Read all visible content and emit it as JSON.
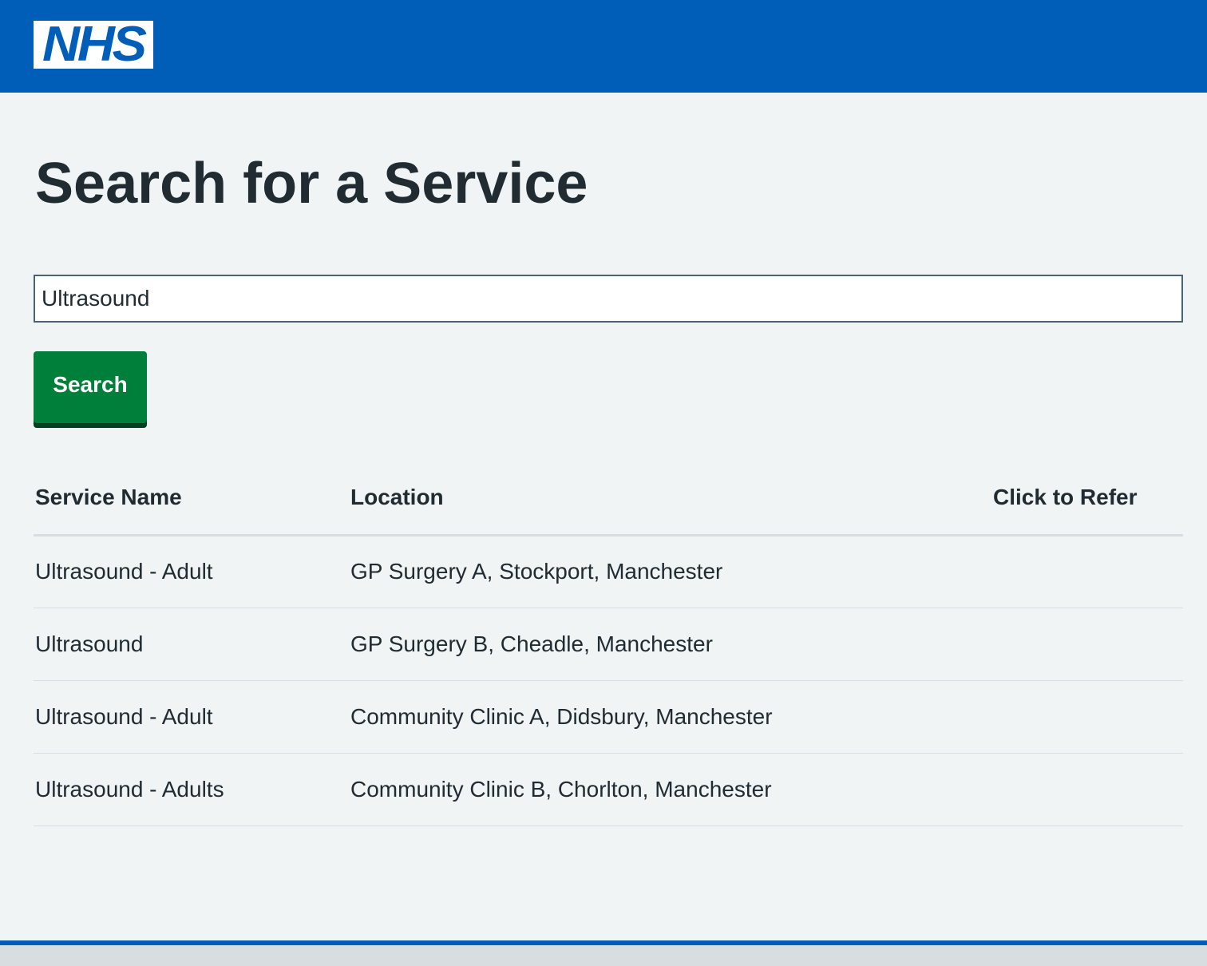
{
  "header": {
    "logo_text": "NHS",
    "brand_color": "#005eb8"
  },
  "page": {
    "title": "Search for a Service"
  },
  "search": {
    "value": "Ultrasound",
    "button_label": "Search",
    "button_color": "#007f3b"
  },
  "table": {
    "headers": {
      "service_name": "Service Name",
      "location": "Location",
      "refer": "Click to Refer"
    },
    "rows": [
      {
        "service_name": "Ultrasound - Adult",
        "location": "GP Surgery A, Stockport, Manchester",
        "refer": ""
      },
      {
        "service_name": "Ultrasound",
        "location": "GP Surgery B, Cheadle, Manchester",
        "refer": ""
      },
      {
        "service_name": "Ultrasound - Adult",
        "location": "Community Clinic A, Didsbury, Manchester",
        "refer": ""
      },
      {
        "service_name": "Ultrasound - Adults",
        "location": "Community Clinic B, Chorlton, Manchester",
        "refer": ""
      }
    ]
  }
}
